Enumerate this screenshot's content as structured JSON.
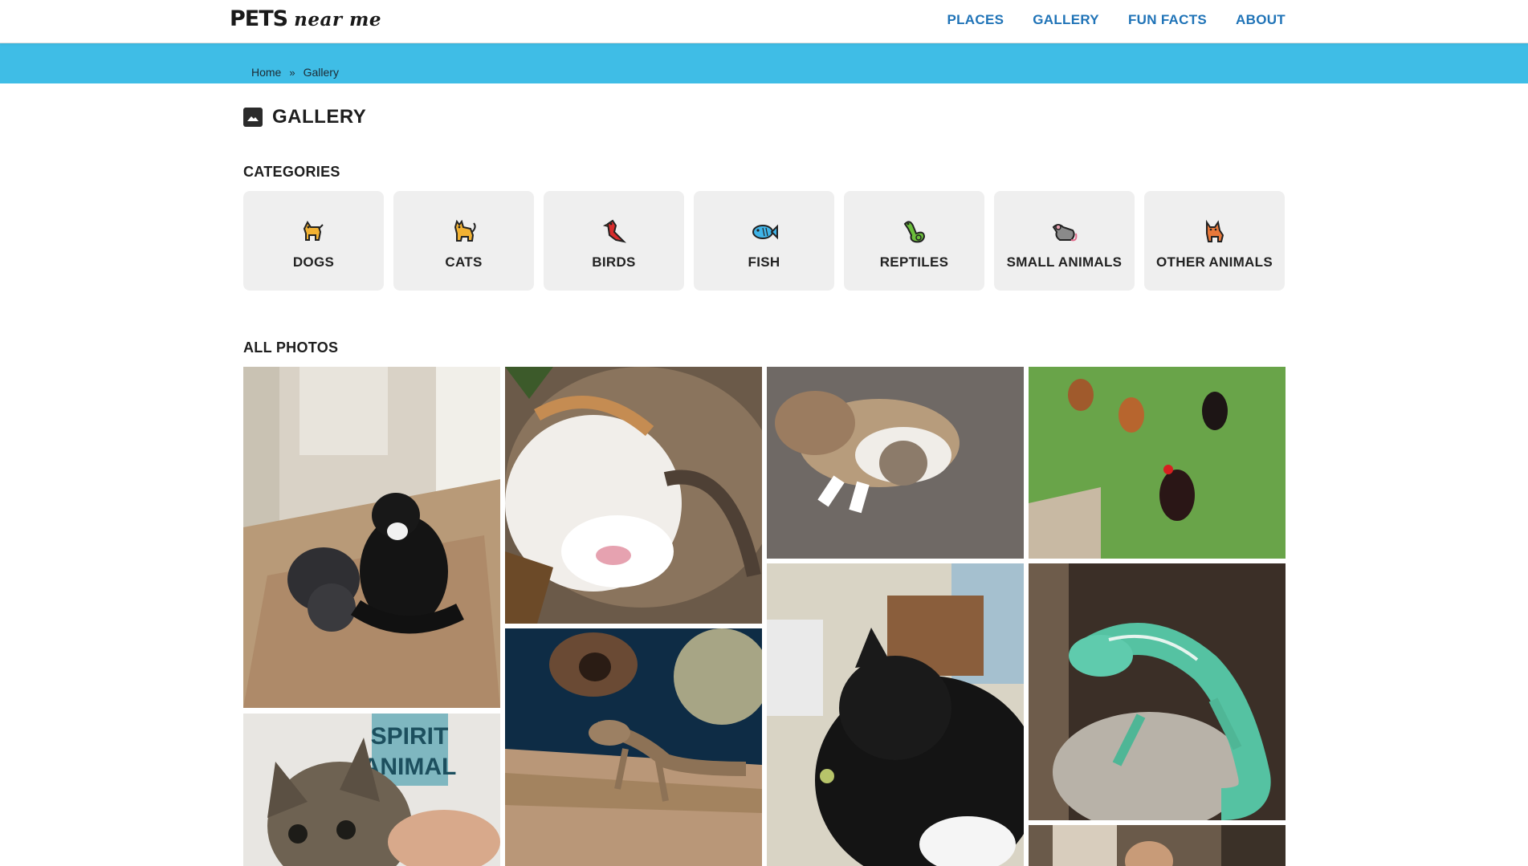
{
  "header": {
    "logo_main": "PETS",
    "logo_sub": "near me",
    "nav": [
      {
        "label": "PLACES"
      },
      {
        "label": "GALLERY"
      },
      {
        "label": "FUN FACTS"
      },
      {
        "label": "ABOUT"
      }
    ]
  },
  "breadcrumb": {
    "home": "Home",
    "separator": "»",
    "current": "Gallery"
  },
  "page": {
    "title": "GALLERY",
    "title_icon": "image-icon",
    "categories_label": "CATEGORIES",
    "all_photos_label": "ALL PHOTOS"
  },
  "categories": [
    {
      "label": "DOGS",
      "icon": "dog-icon"
    },
    {
      "label": "CATS",
      "icon": "cat-icon"
    },
    {
      "label": "BIRDS",
      "icon": "bird-icon"
    },
    {
      "label": "FISH",
      "icon": "fish-icon"
    },
    {
      "label": "REPTILES",
      "icon": "lizard-icon"
    },
    {
      "label": "SMALL ANIMALS",
      "icon": "rat-icon"
    },
    {
      "label": "OTHER ANIMALS",
      "icon": "fox-icon"
    }
  ],
  "photos": {
    "poster_text": "SPIRIT ANIMAL"
  },
  "colors": {
    "accent_band": "#3fbde6",
    "nav_link": "#1f73b7",
    "card_bg": "#efefef"
  }
}
